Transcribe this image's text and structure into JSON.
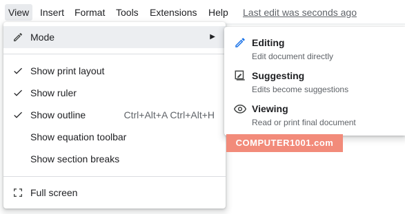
{
  "menubar": {
    "items": [
      {
        "label": "View",
        "active": true
      },
      {
        "label": "Insert"
      },
      {
        "label": "Format"
      },
      {
        "label": "Tools"
      },
      {
        "label": "Extensions"
      },
      {
        "label": "Help"
      }
    ],
    "last_edit": "Last edit was seconds ago"
  },
  "view_menu": {
    "mode": {
      "label": "Mode",
      "icon": "pencil-icon",
      "arrow": "▶"
    },
    "items": [
      {
        "label": "Show print layout",
        "checked": true,
        "icon": "check-icon"
      },
      {
        "label": "Show ruler",
        "checked": true,
        "icon": "check-icon"
      },
      {
        "label": "Show outline",
        "checked": true,
        "icon": "check-icon",
        "shortcut": "Ctrl+Alt+A Ctrl+Alt+H"
      },
      {
        "label": "Show equation toolbar",
        "checked": false
      },
      {
        "label": "Show section breaks",
        "checked": false
      }
    ],
    "full_screen": {
      "label": "Full screen",
      "icon": "fullscreen-icon"
    }
  },
  "mode_submenu": {
    "items": [
      {
        "title": "Editing",
        "description": "Edit document directly",
        "icon": "pencil-icon",
        "icon_color": "#1a73e8"
      },
      {
        "title": "Suggesting",
        "description": "Edits become suggestions",
        "icon": "suggest-edit-icon",
        "icon_color": "#444746"
      },
      {
        "title": "Viewing",
        "description": "Read or print final document",
        "icon": "eye-icon",
        "icon_color": "#444746"
      }
    ]
  },
  "watermark": {
    "text": "COMPUTER1001.com",
    "color": "#f28b7a"
  },
  "colors": {
    "text": "#202124",
    "secondary_text": "#5f6368",
    "highlight": "#eceef1",
    "divider": "#dadce0",
    "accent": "#1a73e8"
  }
}
